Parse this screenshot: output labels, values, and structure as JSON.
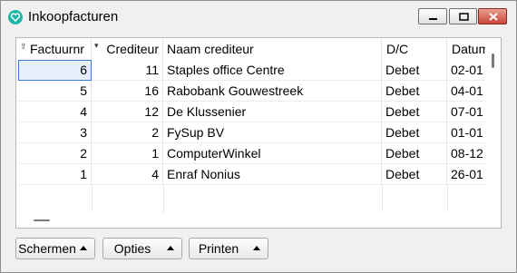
{
  "window": {
    "title": "Inkoopfacturen",
    "colors": {
      "accent": "#1fb8a6",
      "selection": "#3a7bd5",
      "close": "#c9453a"
    }
  },
  "table": {
    "headers": [
      "Factuurnr",
      "Crediteur",
      "Naam crediteur",
      "D/C",
      "Datum"
    ],
    "rows": [
      [
        "6",
        "11",
        "Staples office Centre",
        "Debet",
        "02-01"
      ],
      [
        "5",
        "16",
        "Rabobank Gouwestreek",
        "Debet",
        "04-01"
      ],
      [
        "4",
        "12",
        "De Klussenier",
        "Debet",
        "07-01"
      ],
      [
        "3",
        "2",
        "FySup BV",
        "Debet",
        "01-01"
      ],
      [
        "2",
        "1",
        "ComputerWinkel",
        "Debet",
        "08-12"
      ],
      [
        "1",
        "4",
        "Enraf Nonius",
        "Debet",
        "26-01"
      ]
    ],
    "selected_row": 0
  },
  "toolbar": {
    "schermen_label": "Schermen",
    "opties_label": "Opties",
    "printen_label": "Printen"
  }
}
